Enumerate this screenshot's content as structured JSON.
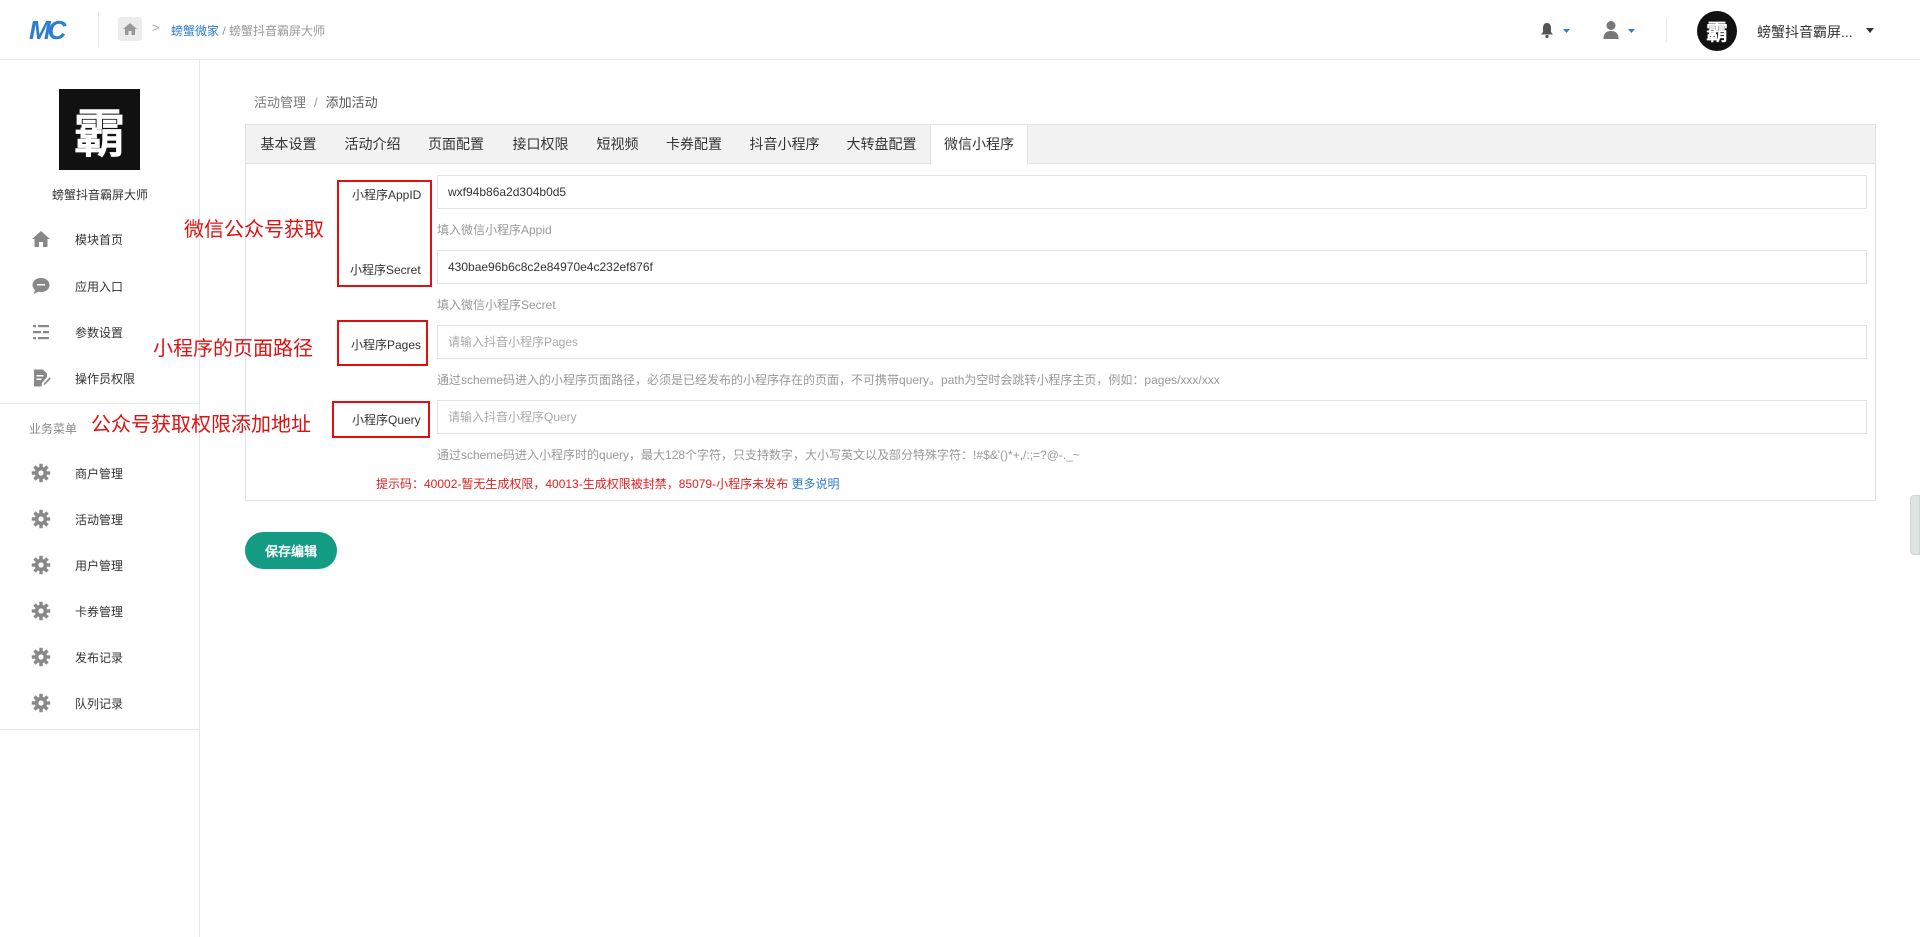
{
  "topbar": {
    "logo_text": "MC",
    "breadcrumb_link": "螃蟹微家",
    "breadcrumb_sep": " / ",
    "breadcrumb_current": "螃蟹抖音霸屏大师",
    "avatar_glyph": "霸",
    "username": "螃蟹抖音霸屏..."
  },
  "sidebar": {
    "avatar_glyph": "霸",
    "name": "螃蟹抖音霸屏大师",
    "items": [
      {
        "label": "模块首页",
        "icon": "home-icon"
      },
      {
        "label": "应用入口",
        "icon": "chat-bubble-icon"
      },
      {
        "label": "参数设置",
        "icon": "list-settings-icon"
      },
      {
        "label": "操作员权限",
        "icon": "edit-document-icon"
      }
    ],
    "section_label": "业务菜单",
    "business_items": [
      {
        "label": "商户管理",
        "icon": "gear-icon"
      },
      {
        "label": "活动管理",
        "icon": "gear-icon"
      },
      {
        "label": "用户管理",
        "icon": "gear-icon"
      },
      {
        "label": "卡券管理",
        "icon": "gear-icon"
      },
      {
        "label": "发布记录",
        "icon": "gear-icon"
      },
      {
        "label": "队列记录",
        "icon": "gear-icon"
      }
    ]
  },
  "breadcrumb": {
    "parent": "活动管理",
    "separator": "/",
    "current": "添加活动"
  },
  "tabs": [
    "基本设置",
    "活动介绍",
    "页面配置",
    "接口权限",
    "短视频",
    "卡券配置",
    "抖音小程序",
    "大转盘配置",
    "微信小程序"
  ],
  "active_tab": "微信小程序",
  "form": {
    "appid": {
      "label": "小程序AppID",
      "value": "wxf94b86a2d304b0d5",
      "help": "填入微信小程序Appid"
    },
    "secret": {
      "label": "小程序Secret",
      "value": "430bae96b6c8c2e84970e4c232ef876f",
      "help": "填入微信小程序Secret"
    },
    "pages": {
      "label": "小程序Pages",
      "value": "",
      "placeholder": "请输入抖音小程序Pages",
      "help": "通过scheme码进入的小程序页面路径，必须是已经发布的小程序存在的页面，不可携带query。path为空时会跳转小程序主页，例如：pages/xxx/xxx"
    },
    "query": {
      "label": "小程序Query",
      "value": "",
      "placeholder": "请输入抖音小程序Query",
      "help": "通过scheme码进入小程序时的query，最大128个字符，只支持数字，大小写英文以及部分特殊字符：!#$&'()*+,/:;=?@-._~"
    },
    "tip": "提示码：40002-暂无生成权限，40013-生成权限被封禁，85079-小程序未发布",
    "tip_link": "更多说明"
  },
  "save_button": "保存编辑",
  "annotations": {
    "appid_secret": "微信公众号获取",
    "pages": "小程序的页面路径",
    "query": "公众号获取权限添加地址"
  },
  "colors": {
    "accent": "#139c83",
    "link": "#2d7dd2",
    "annotation": "#e01010"
  }
}
